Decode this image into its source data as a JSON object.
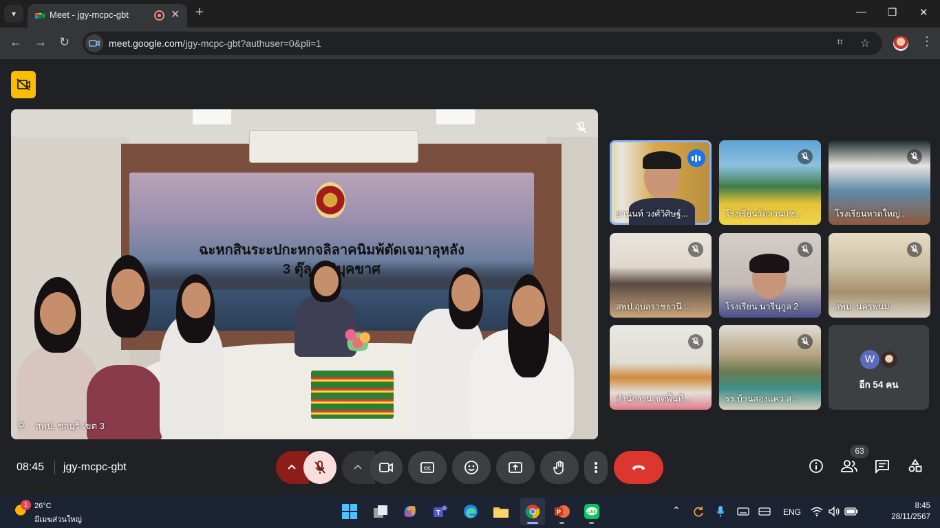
{
  "browser": {
    "tab_title": "Meet - jgy-mcpc-gbt",
    "url_host": "meet.google.com",
    "url_path": "/jgy-mcpc-gbt?authuser=0&pli=1"
  },
  "main_tile": {
    "participant_label": "สพป. ชลบุรี เขต 3",
    "banner_line1": "ฉะหกสินระะปกะหกจลิลาคนิมพ้ตัดเจมาลุหลังจ",
    "banner_line2": "3 ตุ๊ลุ ลุเจิบุคขาศ"
  },
  "tiles": [
    {
      "label": "อานนท์ วงศ์วิศิษฐ์...",
      "speaking": true,
      "bg": "#b98e3e"
    },
    {
      "label": "โรงเรียนวัดลานแซ...",
      "speaking": false,
      "bg": "#d9b94a"
    },
    {
      "label": "โรงเรียนหาดใหญ่...",
      "speaking": false,
      "bg": "#8a9aa6"
    },
    {
      "label": "สพป.อุบลราชธานี ...",
      "speaking": false,
      "bg": "#c9b8a8"
    },
    {
      "label": "โรงเรียน นารีนุกูล 2",
      "speaking": false,
      "bg": "#c9c2bd"
    },
    {
      "label": "สพม. นครพนม",
      "speaking": false,
      "bg": "#c9c3b1"
    },
    {
      "label": "สำนักงานเขตพื้นที่...",
      "speaking": false,
      "bg": "#dcdcd7"
    },
    {
      "label": "รร.บ้านสองแคว ส...",
      "speaking": false,
      "bg": "#bcae95"
    }
  ],
  "more_tile": {
    "avatar_initial": "W",
    "label": "อีก 54 คน"
  },
  "controls": {
    "time": "08:45",
    "meeting_code": "jgy-mcpc-gbt",
    "participant_count": "63"
  },
  "taskbar": {
    "weather_alert_count": "1",
    "weather_temp": "26°C",
    "weather_desc": "มีเมฆส่วนใหญ่",
    "language": "ENG",
    "time": "8:45",
    "date": "28/11/2567"
  },
  "colors": {
    "speaking_outline": "#8ab4f8",
    "hangup_red": "#dc362e",
    "mic_off_bg": "#f9dedc",
    "alert_yellow": "#fbbc04"
  }
}
